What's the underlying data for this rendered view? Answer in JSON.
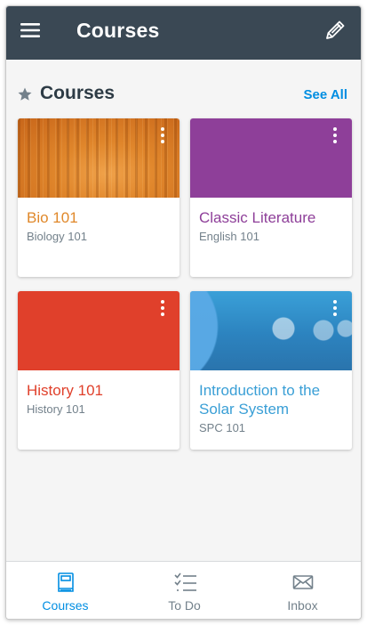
{
  "app_bar": {
    "title": "Courses",
    "background": "#3a4854",
    "menu_icon": "hamburger-menu-icon",
    "edit_icon": "pencil-icon"
  },
  "section": {
    "heading": "Courses",
    "see_all": "See All",
    "star_icon": "star-icon"
  },
  "courses": [
    {
      "name": "Bio 101",
      "code": "Biology 101",
      "color": "#e0882a",
      "banner": "forest-image"
    },
    {
      "name": "Classic Literature",
      "code": "English 101",
      "color": "#8e3f99",
      "banner": "solid-color"
    },
    {
      "name": "History 101",
      "code": "History 101",
      "color": "#e0402b",
      "banner": "solid-color"
    },
    {
      "name": "Introduction to the Solar System",
      "code": "SPC 101",
      "color": "#3a9fd6",
      "banner": "space-image"
    }
  ],
  "bottom_nav": {
    "tabs": [
      {
        "label": "Courses",
        "icon": "book-icon",
        "active": true
      },
      {
        "label": "To Do",
        "icon": "checklist-icon",
        "active": false
      },
      {
        "label": "Inbox",
        "icon": "envelope-icon",
        "active": false
      }
    ],
    "active_color": "#008ee2",
    "inactive_color": "#73818b"
  }
}
